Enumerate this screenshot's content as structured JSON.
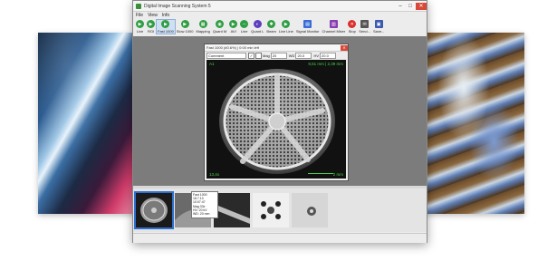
{
  "window": {
    "title": "Digital Image Scanning System 5",
    "controls": [
      "–",
      "□",
      "✕"
    ]
  },
  "menu": [
    "File",
    "View",
    "Info"
  ],
  "toolbar": [
    {
      "label": "Live",
      "icon": "live-icon",
      "color": "#2f9e44"
    },
    {
      "label": "ROI",
      "icon": "roi-icon",
      "color": "#2f9e44"
    },
    {
      "label": "Fast 1000",
      "icon": "fast-scan-icon",
      "color": "#2f9e44",
      "active": true
    },
    {
      "label": "Slow 1000",
      "icon": "slow-scan-icon",
      "color": "#2f9e44"
    },
    {
      "label": "Mapping",
      "icon": "mapping-icon",
      "color": "#2f9e44"
    },
    {
      "label": "Quant M",
      "icon": "quant-m-icon",
      "color": "#2f9e44"
    },
    {
      "label": "AVI",
      "icon": "avi-icon",
      "color": "#2f9e44"
    },
    {
      "label": "Line",
      "icon": "line-icon",
      "color": "#2f9e44"
    },
    {
      "label": "Quant L",
      "icon": "quant-l-icon",
      "color": "#5b3fbf"
    },
    {
      "label": "Beam",
      "icon": "beam-icon",
      "color": "#2f9e44"
    },
    {
      "label": "Live Line",
      "icon": "live-line-icon",
      "color": "#2f9e44"
    },
    {
      "label": "Signal Monitor",
      "icon": "signal-monitor-icon",
      "color": "#3b6bd6"
    },
    {
      "label": "Channel Mixer",
      "icon": "channel-mixer-icon",
      "color": "#8a3fb0"
    },
    {
      "label": "Stop",
      "icon": "stop-icon",
      "color": "#d9302c"
    },
    {
      "label": "Send...",
      "icon": "send-icon",
      "color": "#555555"
    },
    {
      "label": "Save...",
      "icon": "save-icon",
      "color": "#3b5bb0"
    }
  ],
  "image_window": {
    "title": "Fast 1000 (#0.6%) | 0:00 min left",
    "comment_placeholder": "Comment",
    "mag_label": "Mag",
    "mag_value": "20",
    "wd_label": "WD",
    "wd_value": "20.0",
    "hv_label": "HV",
    "hv_value": "20.0",
    "overlay_tl": "A1",
    "overlay_tr": "9,51 mm | 2,39 mm",
    "overlay_bl": "13,4x",
    "overlay_br": "2 mm"
  },
  "tooltip": {
    "lines": [
      "Fast 1000",
      "18.7.10 10:07:47",
      "Mag 33x",
      "HV: 20 kV",
      "WD: 20 mm"
    ]
  },
  "thumbnails": [
    {
      "name": "thumbnail-diatom",
      "selected": true
    },
    {
      "name": "thumbnail-2",
      "selected": false
    },
    {
      "name": "thumbnail-3",
      "selected": false
    },
    {
      "name": "thumbnail-4",
      "selected": false
    },
    {
      "name": "thumbnail-5",
      "selected": false
    }
  ],
  "colors": {
    "overlay_text": "#49d14a",
    "selection": "#2f6fd1",
    "workspace": "#7c7c7c"
  }
}
